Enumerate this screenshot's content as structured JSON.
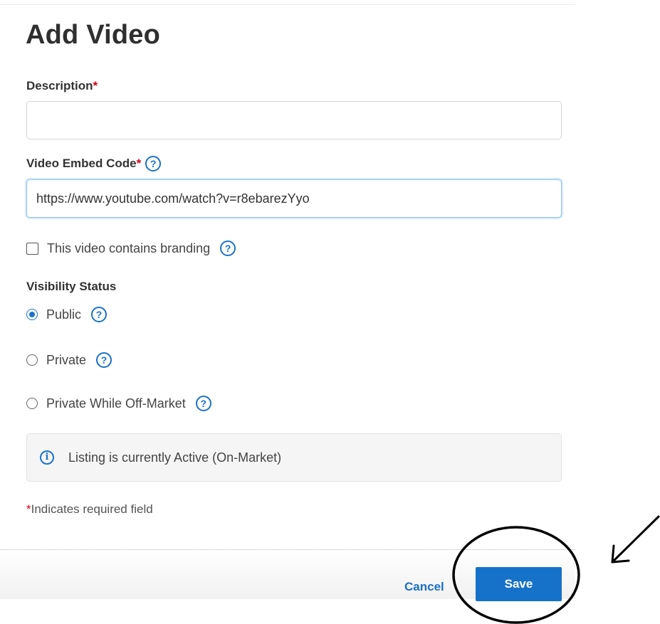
{
  "page": {
    "title": "Add Video"
  },
  "description": {
    "label": "Description",
    "required_mark": "*",
    "value": ""
  },
  "embed_code": {
    "label": "Video Embed Code",
    "required_mark": "*",
    "value": "https://www.youtube.com/watch?v=r8ebarezYyo",
    "help_icon": "?"
  },
  "branding": {
    "label": "This video contains branding",
    "checked": false,
    "help_icon": "?"
  },
  "visibility": {
    "label": "Visibility Status",
    "options": [
      {
        "label": "Public",
        "checked": true,
        "help_icon": "?"
      },
      {
        "label": "Private",
        "checked": false,
        "help_icon": "?"
      },
      {
        "label": "Private While Off-Market",
        "checked": false,
        "help_icon": "?"
      }
    ]
  },
  "info": {
    "icon": "i",
    "text": "Listing is currently Active (On-Market)"
  },
  "footnote": {
    "mark": "*",
    "text": "Indicates required field"
  },
  "footer": {
    "cancel_label": "Cancel",
    "save_label": "Save"
  },
  "colors": {
    "accent": "#1671c9",
    "required": "#d0021b",
    "annotation": "#000000"
  }
}
